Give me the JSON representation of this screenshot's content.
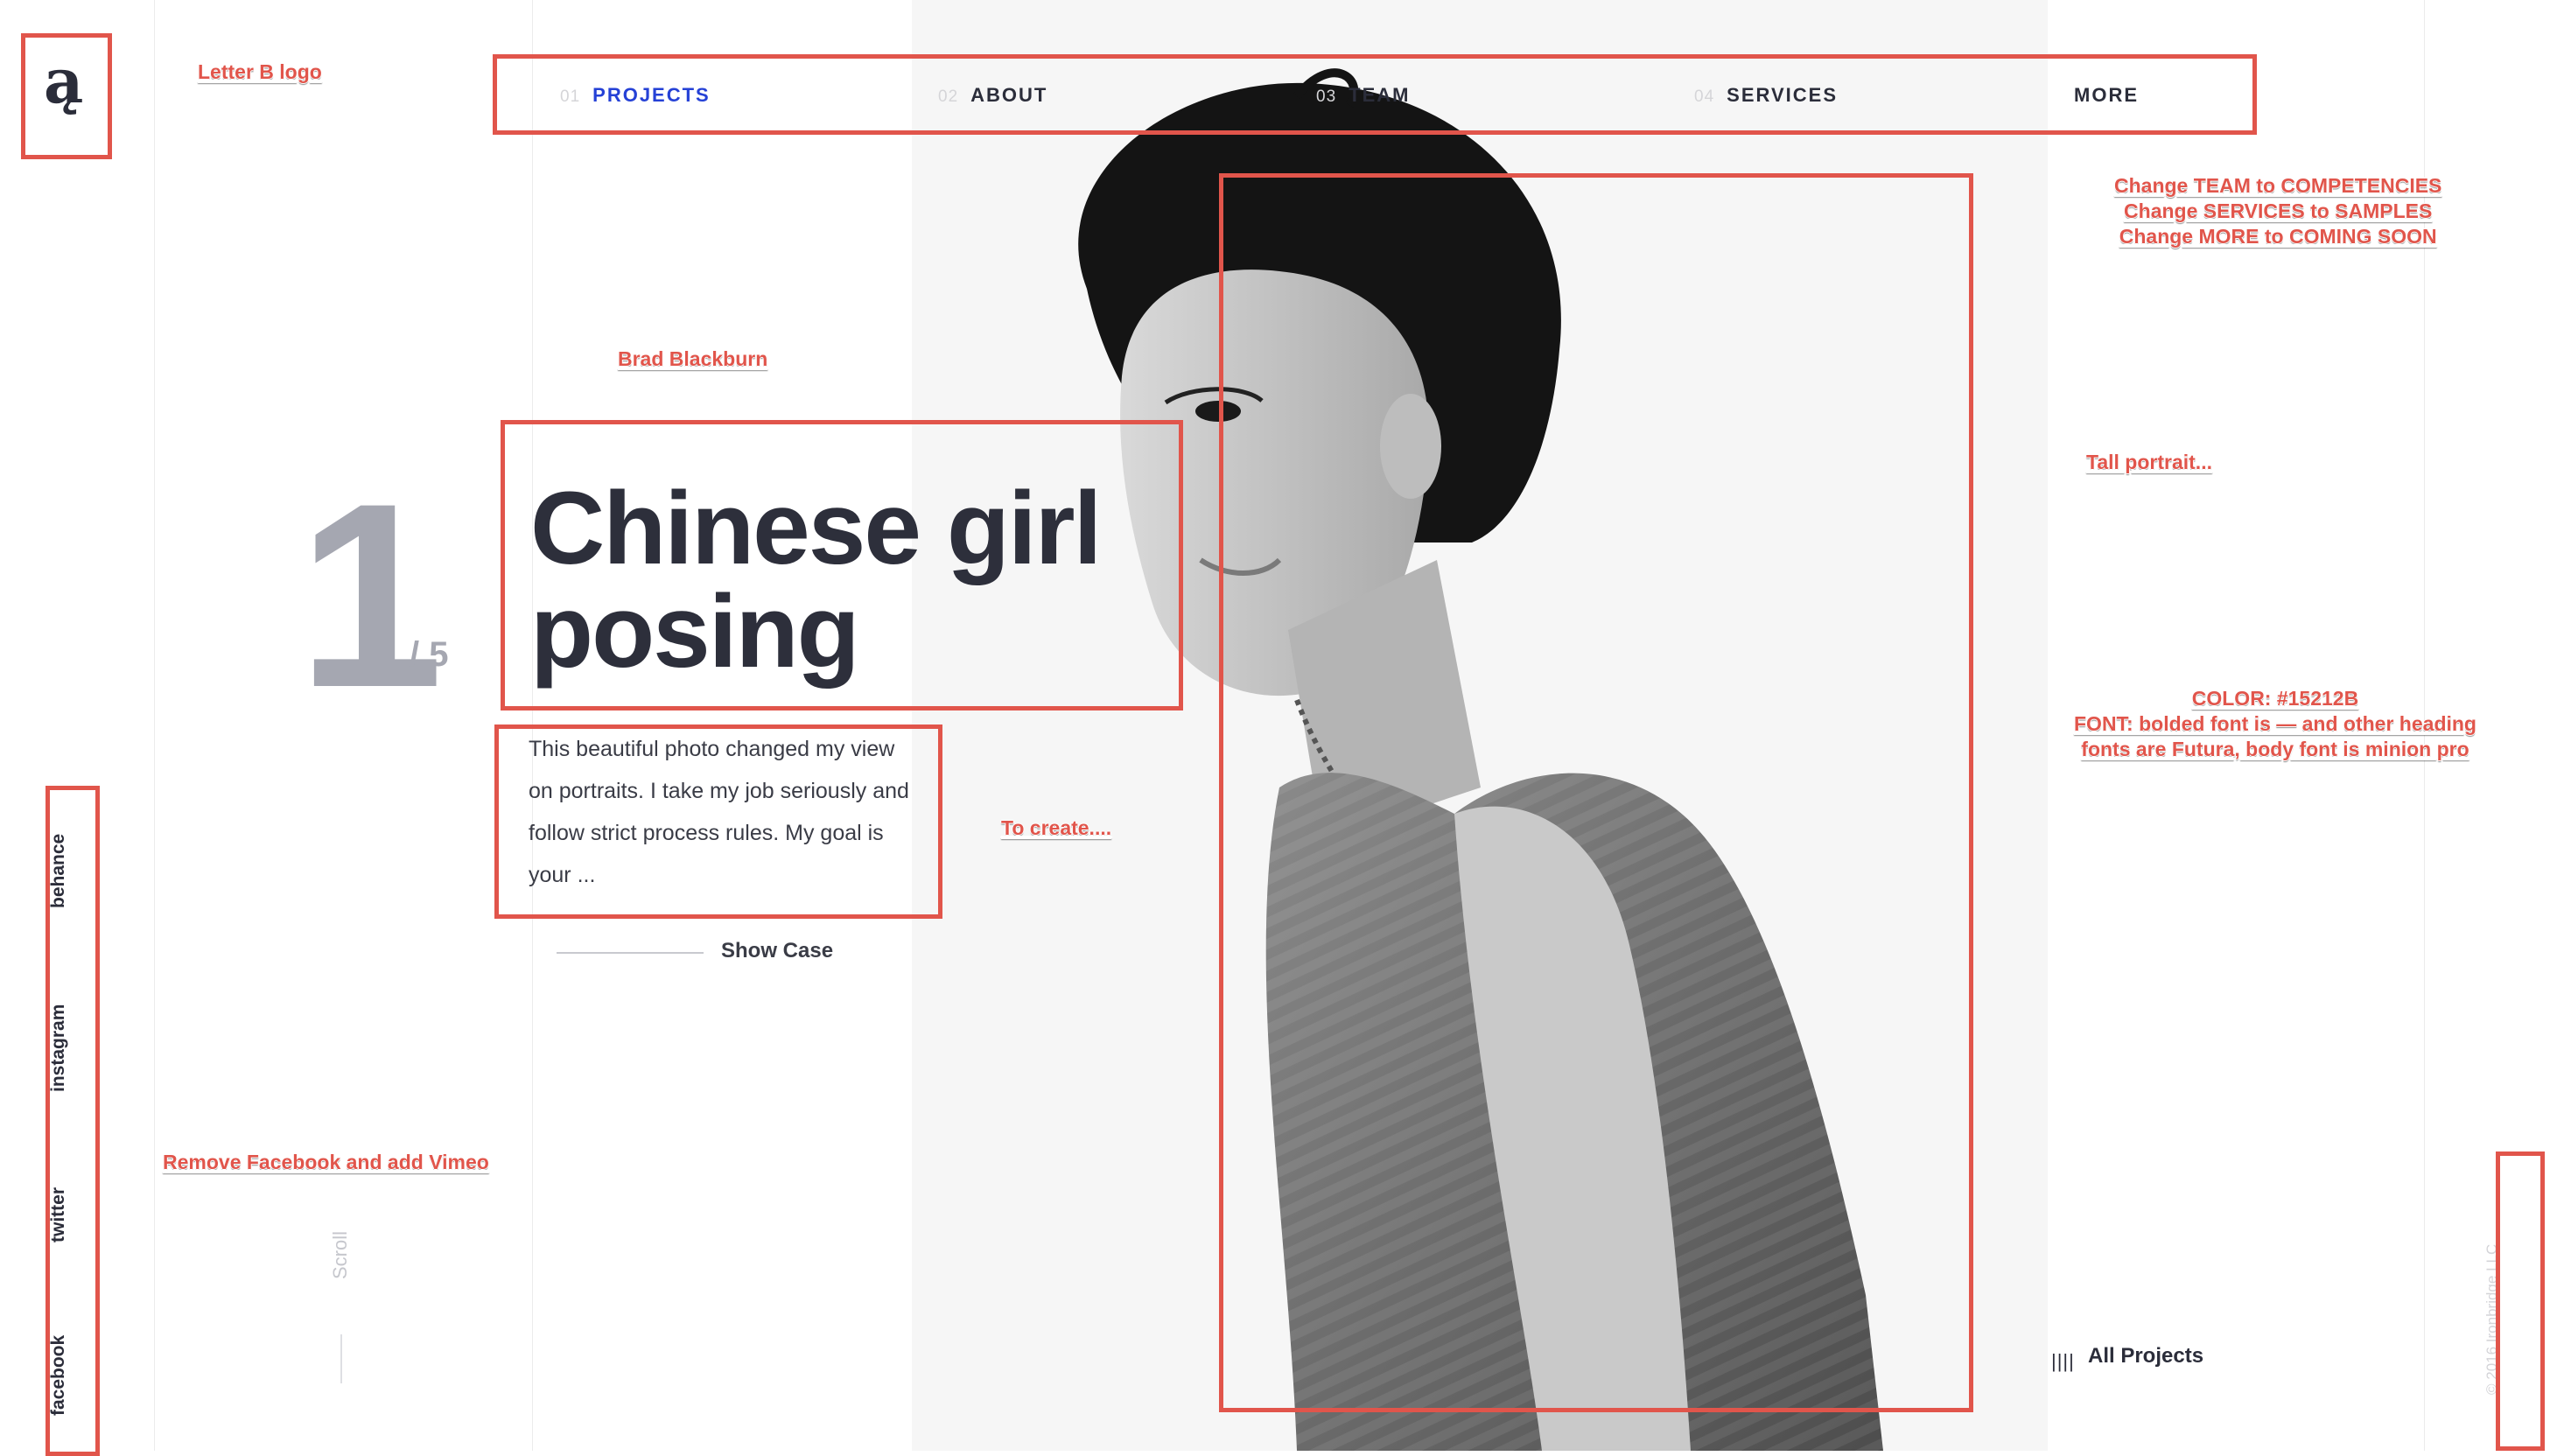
{
  "logo": {
    "glyph": "ą"
  },
  "nav": [
    {
      "num": "01",
      "label": "PROJECTS",
      "active": true
    },
    {
      "num": "02",
      "label": "ABOUT"
    },
    {
      "num": "03",
      "label": "TEAM"
    },
    {
      "num": "04",
      "label": "SERVICES"
    },
    {
      "num": "",
      "label": "MORE"
    }
  ],
  "slide": {
    "current": "1",
    "total": "/ 5",
    "headline_line1": "Chinese girl",
    "headline_line2": "posing",
    "description": "This beautiful photo changed my view on portraits. I take my job seriously and follow strict process rules. My goal is your ...",
    "showcase": "Show Case"
  },
  "social": [
    "behance",
    "instagram",
    "twitter",
    "facebook"
  ],
  "scroll_label": "Scroll",
  "all_projects": {
    "bars": "||||",
    "label": "All Projects"
  },
  "copyright": "© 2016 Ironbridge LLC",
  "annotations": {
    "logo": "Letter B logo",
    "name": "Brad Blackburn",
    "nav_changes": [
      "Change TEAM to COMPETENCIES",
      "Change SERVICES to SAMPLES",
      "Change MORE to COMING SOON"
    ],
    "portrait": "Tall portrait...",
    "style": [
      "COLOR: #15212B",
      "FONT: bolded font is — and other heading",
      "fonts are Futura, body font is minion pro"
    ],
    "create": "To create....",
    "social": "Remove Facebook and add Vimeo"
  },
  "colors": {
    "accent": "#2541d6",
    "markup_red": "#e1554b",
    "heading": "#2d2f3b",
    "muted": "#a5a7b1"
  }
}
